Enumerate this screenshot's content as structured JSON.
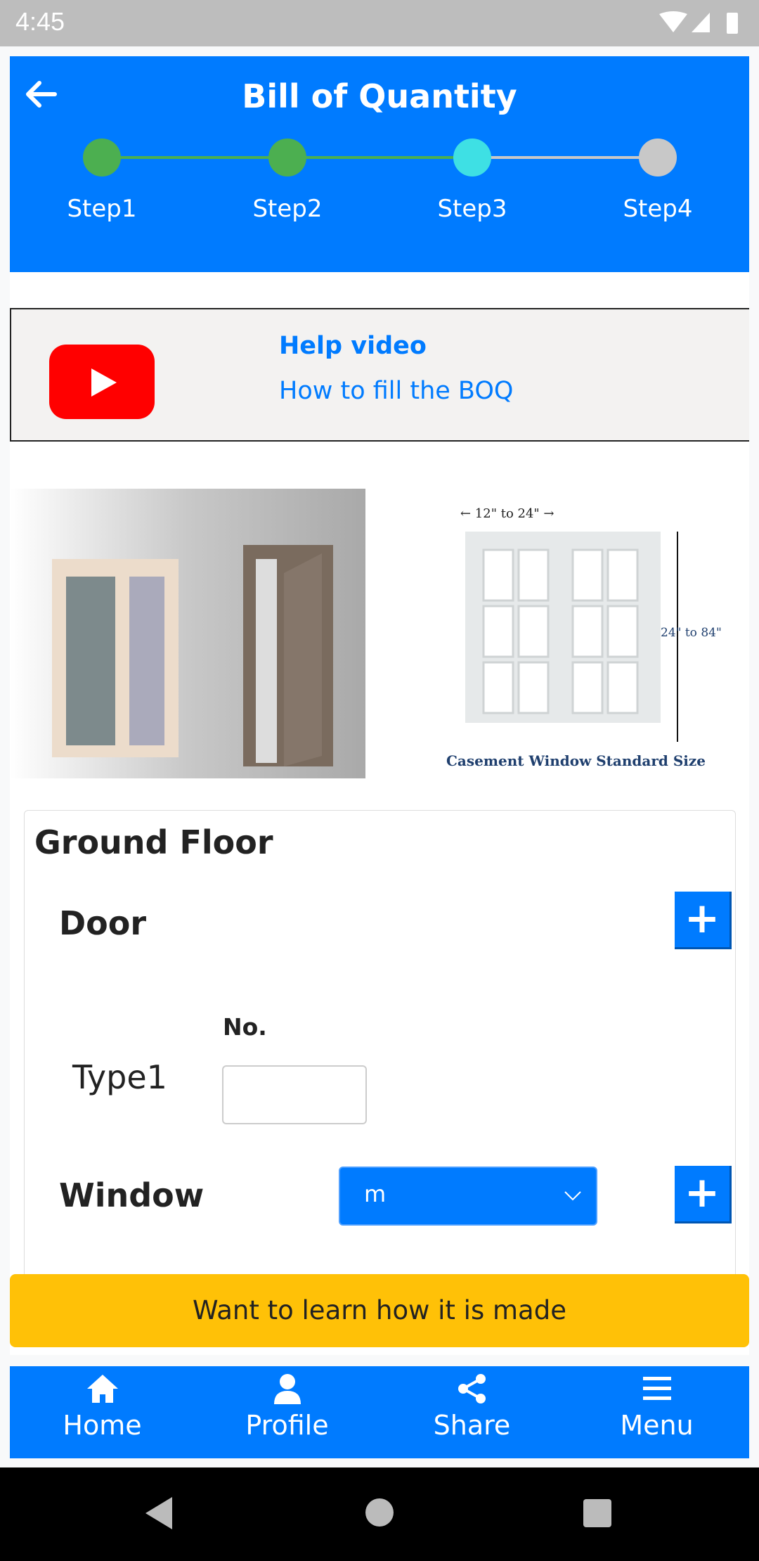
{
  "status_bar": {
    "time": "4:45",
    "icons": [
      "wifi-icon",
      "signal-icon",
      "battery-icon"
    ]
  },
  "header": {
    "title": "Bill of Quantity",
    "back_icon": "arrow-left-icon",
    "steps": [
      {
        "label": "Step1",
        "state": "done",
        "color": "#4caf50"
      },
      {
        "label": "Step2",
        "state": "done",
        "color": "#4caf50"
      },
      {
        "label": "Step3",
        "state": "current",
        "color": "#3ee0e4"
      },
      {
        "label": "Step4",
        "state": "pending",
        "color": "#c8c8c8"
      }
    ]
  },
  "help": {
    "title": "Help video",
    "link": "How to fill the BOQ",
    "icon": "youtube-icon"
  },
  "images": {
    "casement_top": "← 12\" to 24\" →",
    "casement_side": "24\" to 84\"",
    "casement_caption": "Casement Window Standard Size"
  },
  "card": {
    "floor": "Ground Floor",
    "door_label": "Door",
    "no_label": "No.",
    "type_label": "Type1",
    "no_value": "",
    "window_label": "Window",
    "window_select": "m"
  },
  "learn_button": "Want to learn how it is made",
  "bottom_nav": [
    {
      "label": "Home",
      "icon": "home-icon"
    },
    {
      "label": "Profile",
      "icon": "user-icon"
    },
    {
      "label": "Share",
      "icon": "share-icon"
    },
    {
      "label": "Menu",
      "icon": "menu-icon"
    }
  ],
  "colors": {
    "primary": "#007bff",
    "warning": "#ffc107"
  }
}
